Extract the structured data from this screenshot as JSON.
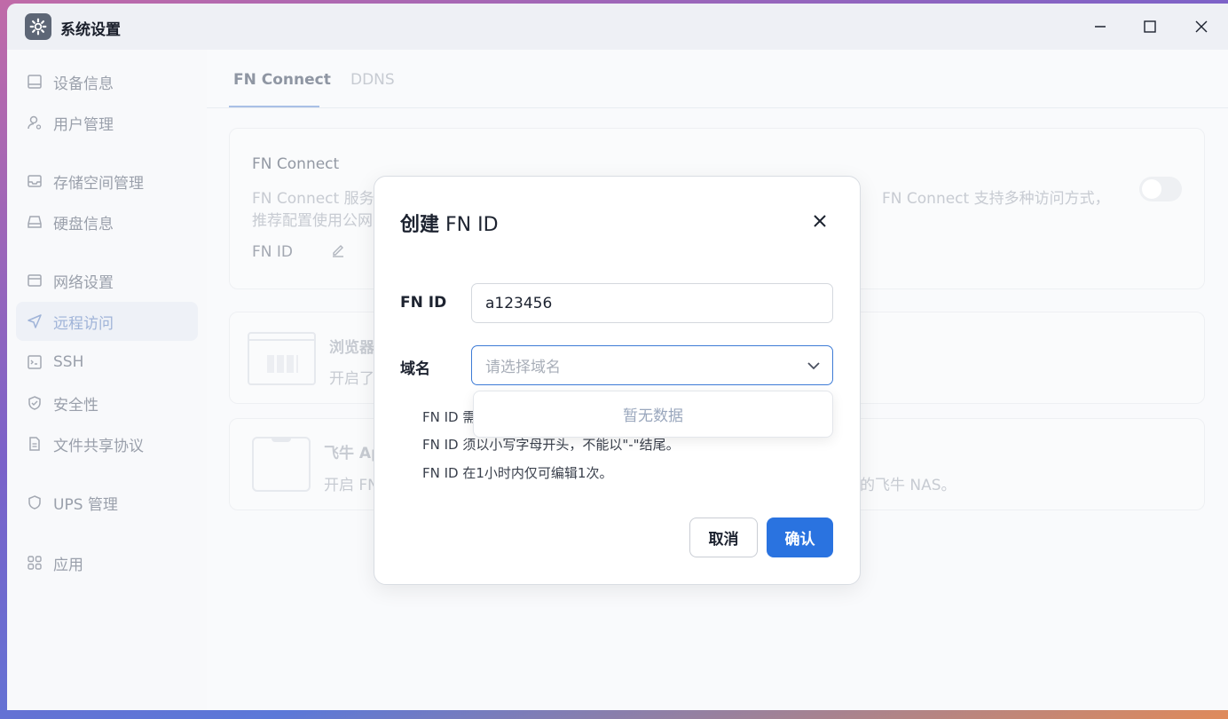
{
  "window": {
    "title": "系统设置"
  },
  "sidebar": {
    "items": [
      {
        "label": "设备信息",
        "icon": "monitor-icon"
      },
      {
        "label": "用户管理",
        "icon": "user-icon"
      },
      {
        "label": "存储空间管理",
        "icon": "storage-icon"
      },
      {
        "label": "硬盘信息",
        "icon": "disk-icon"
      },
      {
        "label": "网络设置",
        "icon": "network-icon"
      },
      {
        "label": "远程访问",
        "icon": "send-icon",
        "active": true
      },
      {
        "label": "SSH",
        "icon": "terminal-icon"
      },
      {
        "label": "安全性",
        "icon": "shield-check-icon"
      },
      {
        "label": "文件共享协议",
        "icon": "file-icon"
      },
      {
        "label": "UPS 管理",
        "icon": "ups-shield-icon"
      },
      {
        "label": "应用",
        "icon": "apps-grid-icon"
      }
    ]
  },
  "tabs": [
    {
      "label": "FN Connect",
      "active": true
    },
    {
      "label": "DDNS",
      "active": false
    }
  ],
  "fn_connect_card": {
    "title": "FN Connect",
    "desc_left": "FN Connect 服务",
    "desc_right": "FN Connect 支持多种访问方式，",
    "desc_line2": "推荐配置使用公网",
    "fnid_label": "FN ID"
  },
  "browser_card": {
    "title": "浏览器",
    "desc": "开启了"
  },
  "app_card": {
    "title": "飞牛 Ap",
    "desc": "开启 FN",
    "desc_right": "的飞牛 NAS。"
  },
  "modal": {
    "title_prefix": "创建",
    "title_suffix": " FN ID",
    "fnid_label": "FN ID",
    "fnid_value": "a123456",
    "domain_label": "域名",
    "domain_placeholder": "请选择域名",
    "dropdown_empty": "暂无数据",
    "hints": [
      "FN ID 需",
      "FN ID 须以小写字母开头，不能以\"-\"结尾。",
      "FN ID 在1小时内仅可编辑1次。"
    ],
    "cancel_label": "取消",
    "confirm_label": "确认"
  },
  "colors": {
    "primary": "#2a73e0",
    "select_border": "#3d7bd6",
    "active_nav_bg": "#eef1f7"
  }
}
